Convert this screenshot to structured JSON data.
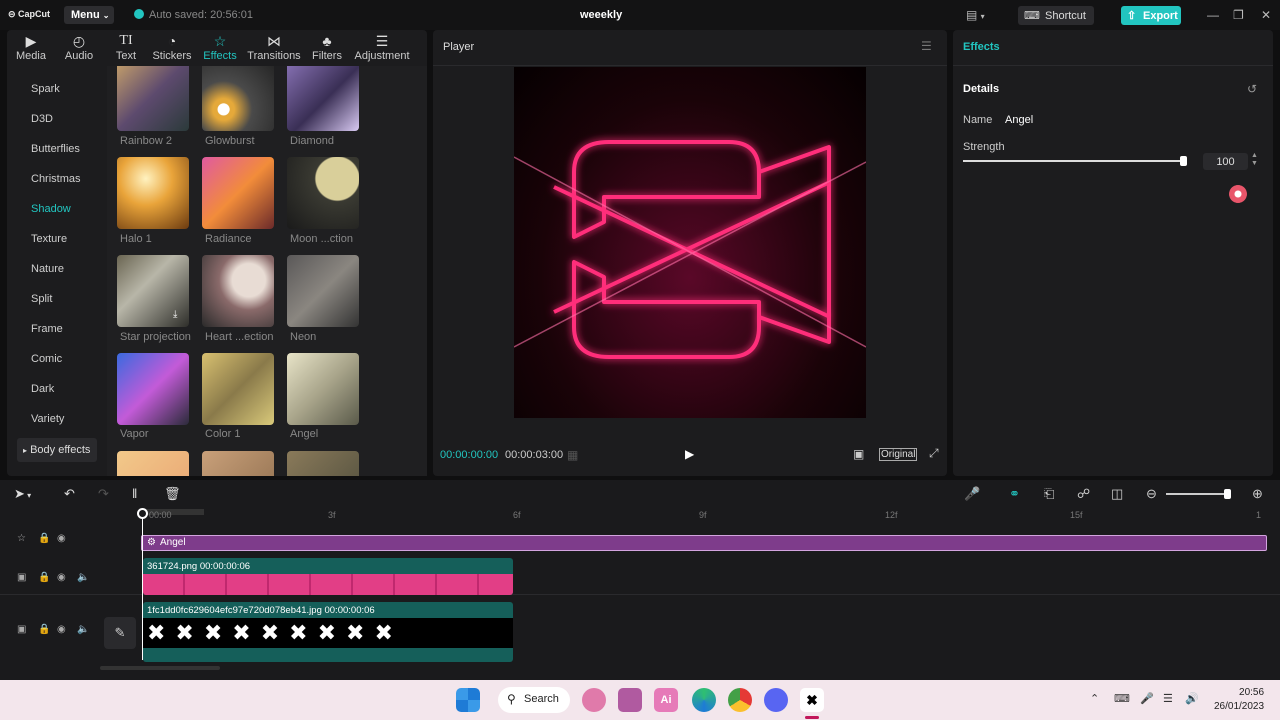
{
  "titlebar": {
    "app_name": "CapCut",
    "menu_label": "Menu",
    "autosave_text": "Auto saved: 20:56:01",
    "project_title": "weeekly",
    "shortcut_label": "Shortcut",
    "export_label": "Export"
  },
  "left_panel": {
    "tabs": [
      {
        "label": "Media",
        "icon": "media-icon"
      },
      {
        "label": "Audio",
        "icon": "audio-icon"
      },
      {
        "label": "Text",
        "icon": "text-icon"
      },
      {
        "label": "Stickers",
        "icon": "stickers-icon"
      },
      {
        "label": "Effects",
        "icon": "effects-icon",
        "active": true
      },
      {
        "label": "Transitions",
        "icon": "transitions-icon"
      },
      {
        "label": "Filters",
        "icon": "filters-icon"
      },
      {
        "label": "Adjustment",
        "icon": "adjustment-icon"
      }
    ],
    "categories": [
      "Spark",
      "D3D",
      "Butterflies",
      "Christmas",
      "Shadow",
      "Texture",
      "Nature",
      "Split",
      "Frame",
      "Comic",
      "Dark",
      "Variety"
    ],
    "active_category": "Shadow",
    "body_effects_label": "Body effects",
    "effects": [
      {
        "label": "Rainbow 2"
      },
      {
        "label": "Glowburst"
      },
      {
        "label": "Diamond"
      },
      {
        "label": "Halo 1"
      },
      {
        "label": "Radiance"
      },
      {
        "label": "Moon ...ction"
      },
      {
        "label": "Star projection"
      },
      {
        "label": "Heart ...ection"
      },
      {
        "label": "Neon"
      },
      {
        "label": "Vapor"
      },
      {
        "label": "Color 1"
      },
      {
        "label": "Angel"
      }
    ]
  },
  "player": {
    "title": "Player",
    "current_time": "00:00:00:00",
    "total_time": "00:00:03:00",
    "ratio_label": "Original"
  },
  "right_panel": {
    "title": "Effects",
    "details_label": "Details",
    "name_label": "Name",
    "name_value": "Angel",
    "strength_label": "Strength",
    "strength_value": "100",
    "strength_fraction": 1.0
  },
  "timeline": {
    "ruler": [
      "00:00",
      "3f",
      "6f",
      "9f",
      "12f",
      "15f",
      "1"
    ],
    "effect_clip_label": "Angel",
    "clip1_label": "361724.png  00:00:00:06",
    "clip2_label": "1fc1dd0fc629604efc97e720d078eb41.jpg  00:00:00:06"
  },
  "taskbar": {
    "search_label": "Search",
    "time": "20:56",
    "date": "26/01/2023"
  },
  "colors": {
    "accent": "#22c5c0",
    "effect_clip": "#7e3c8b",
    "media_clip": "#155f5a",
    "neon_pink": "#ff2d7a"
  }
}
